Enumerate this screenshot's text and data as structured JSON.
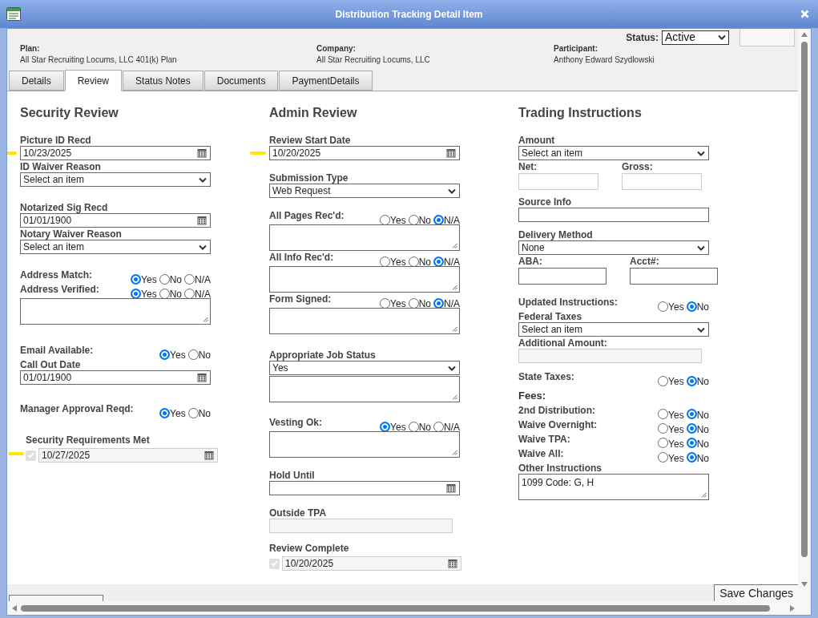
{
  "window": {
    "title": "Distribution Tracking Detail Item"
  },
  "header": {
    "status_label": "Status:",
    "status_value": "Active",
    "info": [
      {
        "label": "Plan:",
        "value": "All Star Recruiting Locums, LLC 401(k) Plan"
      },
      {
        "label": "Company:",
        "value": "All Star Recruiting Locums, LLC"
      },
      {
        "label": "Participant:",
        "value": "Anthony Edward Szydlowski"
      }
    ]
  },
  "tabs": [
    {
      "label": "Details",
      "selected": false
    },
    {
      "label": "Review",
      "selected": true
    },
    {
      "label": "Status Notes",
      "selected": false
    },
    {
      "label": "Documents",
      "selected": false
    },
    {
      "label": "PaymentDetails",
      "selected": false
    }
  ],
  "columns": [
    {
      "title": "Security Review",
      "groups": [
        [
          {
            "kind": "date",
            "label": "Picture ID Recd",
            "value": "10/23/2025",
            "flagged": true
          },
          {
            "kind": "select",
            "label": "ID Waiver Reason",
            "value": "Select an item"
          }
        ],
        [
          {
            "kind": "date",
            "label": "Notarized Sig Recd",
            "value": "01/01/1900",
            "flagged": false
          },
          {
            "kind": "select",
            "label": "Notary Waiver Reason",
            "value": "Select an item"
          }
        ],
        [
          {
            "kind": "radio",
            "label": "Address Match:",
            "options": [
              {
                "label": "Yes",
                "selected": true
              },
              {
                "label": "No",
                "selected": false
              },
              {
                "label": "N/A",
                "selected": false
              }
            ]
          },
          {
            "kind": "radio",
            "label": "Address Verified:",
            "options": [
              {
                "label": "Yes",
                "selected": true
              },
              {
                "label": "No",
                "selected": false
              },
              {
                "label": "N/A",
                "selected": false
              }
            ]
          },
          {
            "kind": "textarea"
          }
        ],
        [
          {
            "kind": "radio",
            "label": "Email Available:",
            "options": [
              {
                "label": "Yes",
                "selected": true
              },
              {
                "label": "No",
                "selected": false
              }
            ]
          },
          {
            "kind": "date",
            "label": "Call Out Date",
            "value": "01/01/1900",
            "flagged": false
          }
        ],
        [
          {
            "kind": "radio",
            "label": "Manager Approval Reqd:",
            "options": [
              {
                "label": "Yes",
                "selected": true
              },
              {
                "label": "No",
                "selected": false
              }
            ]
          }
        ],
        [
          {
            "kind": "checkdate",
            "label": "Security Requirements Met",
            "checked": true,
            "value": "10/27/2025",
            "flagged": true
          }
        ]
      ]
    },
    {
      "title": "Admin Review",
      "groups": [
        [
          {
            "kind": "date",
            "label": "Review Start Date",
            "value": "10/20/2025",
            "flagged": true
          }
        ],
        [
          {
            "kind": "select",
            "label": "Submission Type",
            "value": "Web Request"
          }
        ],
        [
          {
            "kind": "radio",
            "label": "All Pages Rec'd:",
            "options": [
              {
                "label": "Yes",
                "selected": false
              },
              {
                "label": "No",
                "selected": false
              },
              {
                "label": "N/A",
                "selected": true
              }
            ]
          },
          {
            "kind": "textarea"
          },
          {
            "kind": "radio",
            "label": "All Info Rec'd:",
            "options": [
              {
                "label": "Yes",
                "selected": false
              },
              {
                "label": "No",
                "selected": false
              },
              {
                "label": "N/A",
                "selected": true
              }
            ]
          },
          {
            "kind": "textarea"
          },
          {
            "kind": "radio",
            "label": "Form Signed:",
            "options": [
              {
                "label": "Yes",
                "selected": false
              },
              {
                "label": "No",
                "selected": false
              },
              {
                "label": "N/A",
                "selected": true
              }
            ]
          },
          {
            "kind": "textarea"
          }
        ],
        [
          {
            "kind": "select",
            "label": "Appropriate Job Status",
            "value": "Yes"
          },
          {
            "kind": "textarea"
          }
        ],
        [
          {
            "kind": "radio",
            "label": "Vesting Ok:",
            "options": [
              {
                "label": "Yes",
                "selected": true
              },
              {
                "label": "No",
                "selected": false
              },
              {
                "label": "N/A",
                "selected": false
              }
            ]
          },
          {
            "kind": "textarea"
          }
        ],
        [
          {
            "kind": "date",
            "label": "Hold Until",
            "flagged": false
          }
        ],
        [
          {
            "kind": "text",
            "label": "Outside TPA",
            "disabled": true
          }
        ],
        [
          {
            "kind": "checkdate",
            "label": "Review Complete",
            "checked": true,
            "value": "10/20/2025",
            "flagged": false
          }
        ]
      ]
    },
    {
      "title": "Trading Instructions",
      "groups": [
        [
          {
            "kind": "select",
            "label": "Amount",
            "value": "Select an item"
          },
          {
            "kind": "pair",
            "fields": [
              {
                "label": "Net:",
                "disabled": true
              },
              {
                "label": "Gross:",
                "disabled": true
              }
            ]
          }
        ],
        [
          {
            "kind": "text",
            "label": "Source Info",
            "disabled": false
          }
        ],
        [
          {
            "kind": "select",
            "label": "Delivery Method",
            "value": "None"
          },
          {
            "kind": "pair",
            "fields": [
              {
                "label": "ABA:",
                "disabled": false
              },
              {
                "label": "Acct#:",
                "disabled": false
              }
            ]
          }
        ],
        [
          {
            "kind": "radio",
            "label": "Updated Instructions:",
            "options": [
              {
                "label": "Yes",
                "selected": false
              },
              {
                "label": "No",
                "selected": true
              }
            ]
          },
          {
            "kind": "select",
            "label": "Federal Taxes",
            "value": "Select an item"
          },
          {
            "kind": "text",
            "label": "Additional Amount:",
            "disabled": true
          }
        ],
        [
          {
            "kind": "radio",
            "label": "State Taxes:",
            "options": [
              {
                "label": "Yes",
                "selected": false
              },
              {
                "label": "No",
                "selected": true
              }
            ]
          }
        ],
        [
          {
            "kind": "heading",
            "label": "Fees:"
          },
          {
            "kind": "radio",
            "label": "2nd Distribution:",
            "options": [
              {
                "label": "Yes",
                "selected": false
              },
              {
                "label": "No",
                "selected": true
              }
            ]
          },
          {
            "kind": "radio",
            "label": "Waive Overnight:",
            "options": [
              {
                "label": "Yes",
                "selected": false
              },
              {
                "label": "No",
                "selected": true
              }
            ]
          },
          {
            "kind": "radio",
            "label": "Waive TPA:",
            "options": [
              {
                "label": "Yes",
                "selected": false
              },
              {
                "label": "No",
                "selected": true
              }
            ]
          },
          {
            "kind": "radio",
            "label": "Waive All:",
            "options": [
              {
                "label": "Yes",
                "selected": false
              },
              {
                "label": "No",
                "selected": true
              }
            ]
          },
          {
            "kind": "textarea",
            "label": "Other Instructions",
            "value": "1099 Code: G, H"
          }
        ]
      ]
    }
  ],
  "footer": {
    "save_button": "Save Changes"
  }
}
